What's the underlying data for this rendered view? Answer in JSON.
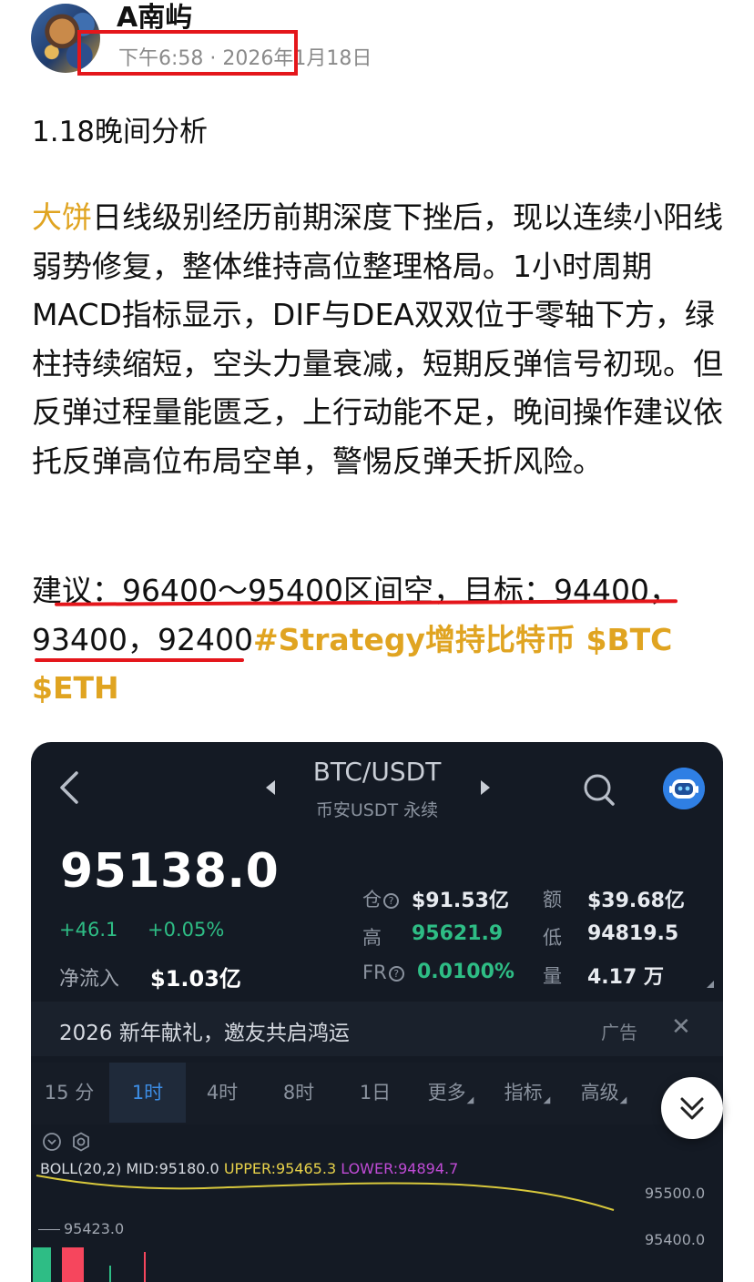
{
  "post": {
    "author": "A南屿",
    "time": "下午6:58 · 2026年1月18日",
    "title": "1.18晚间分析",
    "tag": "大饼",
    "body": "日线级别经历前期深度下挫后，现以连续小阳线弱势修复，整体维持高位整理格局。1小时周期MACD指标显示，DIF与DEA双双位于零轴下方，绿柱持续缩短，空头力量衰减，短期反弹信号初现。但反弹过程量能匮乏，上行动能不足，晚间操作建议依托反弹高位布局空单，警惕反弹夭折风险。",
    "advice": "建议：96400～95400区间空，目标：94400，93400，92400",
    "topics": "#Strategy增持比特币 $BTC $ETH"
  },
  "trading": {
    "pair": "BTC/USDT",
    "market": "币安USDT 永续",
    "price": "95138.0",
    "change": "+46.1",
    "change_pct": "+0.05%",
    "net_inflow_label": "净流入",
    "net_inflow": "$1.03亿",
    "stats": {
      "oi_label": "仓",
      "oi": "$91.53亿",
      "amount_label": "额",
      "amount": "$39.68亿",
      "high_label": "高",
      "high": "95621.9",
      "low_label": "低",
      "low": "94819.5",
      "fr_label": "FR",
      "fr": "0.0100%",
      "vol_label": "量",
      "vol": "4.17 万"
    },
    "banner": "2026 新年献礼，邀友共启鸿运",
    "ad_label": "广告",
    "tabs": [
      "15 分",
      "1时",
      "4时",
      "8时",
      "1日",
      "更多",
      "指标",
      "高级"
    ],
    "active_tab": "1时",
    "boll": {
      "name": "BOLL(20,2)",
      "mid": "MID:95180.0",
      "upper": "UPPER:95465.3",
      "lower": "LOWER:94894.7"
    },
    "axis": [
      "95500.0",
      "95400.0"
    ],
    "high_marker": "95423.0"
  },
  "colors": {
    "accent": "#e0a421",
    "highlight": "#e4161b",
    "up": "#2ebd85",
    "down": "#f6465d",
    "link_blue": "#3d8ee6"
  }
}
